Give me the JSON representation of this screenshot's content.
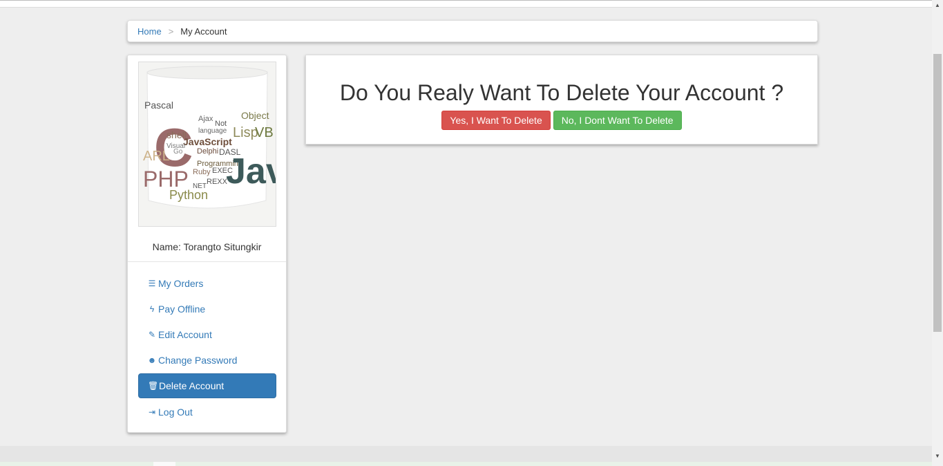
{
  "breadcrumb": {
    "home": "Home",
    "separator": ">",
    "current": "My Account"
  },
  "profile": {
    "name": "Name: Torangto Situngkir",
    "image_words": [
      "Pascal",
      "C",
      "Ajax",
      "shell",
      "JavaScript",
      "Lisp",
      "VB",
      "Object",
      "Visual",
      "Delphi",
      "DASL",
      "ARL",
      "PHP",
      "Ruby",
      "EXEC",
      "Programming",
      "Jav",
      "NET",
      "REXX",
      "Python",
      "Go",
      "language",
      "Not"
    ]
  },
  "menu": [
    {
      "label": "My Orders",
      "icon": "list-icon",
      "glyph": "☰"
    },
    {
      "label": "Pay Offline",
      "icon": "flash-icon",
      "glyph": "ϟ"
    },
    {
      "label": "Edit Account",
      "icon": "pencil-icon",
      "glyph": "✎"
    },
    {
      "label": "Change Password",
      "icon": "user-icon",
      "glyph": "☻"
    },
    {
      "label": "Delete Account",
      "icon": "trash-icon",
      "glyph": "🗑"
    },
    {
      "label": "Log Out",
      "icon": "logout-icon",
      "glyph": "⇥"
    }
  ],
  "panel": {
    "title": "Do You Realy Want To Delete Your Account ?",
    "confirm_label": "Yes, I Want To Delete",
    "cancel_label": "No, I Dont Want To Delete"
  },
  "colors": {
    "danger": "#d9534f",
    "success": "#5cb85c",
    "primary": "#337ab7",
    "background": "#eeeeee"
  }
}
